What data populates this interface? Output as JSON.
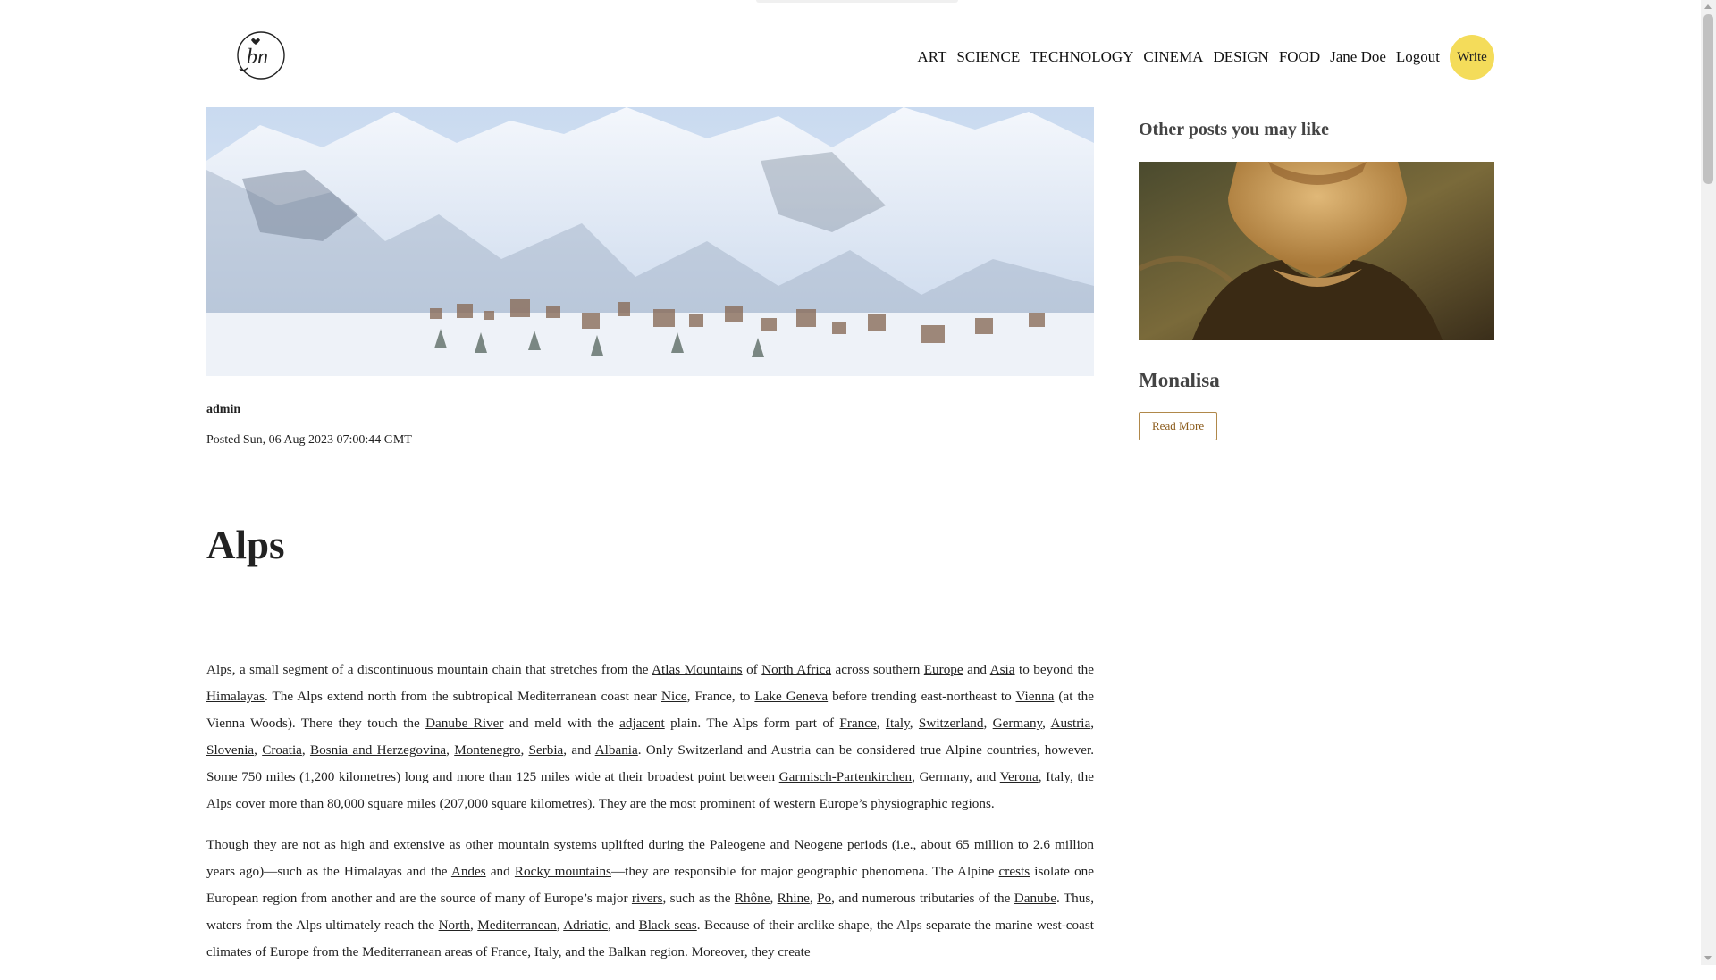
{
  "header": {
    "nav": [
      {
        "label": "ART"
      },
      {
        "label": "SCIENCE"
      },
      {
        "label": "TECHNOLOGY"
      },
      {
        "label": "CINEMA"
      },
      {
        "label": "DESIGN"
      },
      {
        "label": "FOOD"
      },
      {
        "label": "Jane Doe"
      },
      {
        "label": "Logout"
      }
    ],
    "write_label": "Write",
    "logo_icon": "bn-logo-icon"
  },
  "post": {
    "author": "admin",
    "posted": "Posted Sun, 06 Aug 2023 07:00:44 GMT",
    "title": "Alps",
    "hero_image": "snowy-alpine-village-image"
  },
  "article": {
    "p1": [
      "Alps, a small segment of a discontinuous mountain chain that stretches from the ",
      "Atlas Mountains",
      " of ",
      "North Africa",
      " across southern ",
      "Europe",
      " and ",
      "Asia",
      " to beyond the ",
      "Himalayas",
      ". The Alps extend north from the subtropical Mediterranean coast near ",
      "Nice",
      ", France, to ",
      "Lake Geneva",
      " before trending east-northeast to ",
      "Vienna",
      " (at the Vienna Woods). There they touch the ",
      "Danube River",
      " and meld with the ",
      "adjacent",
      " plain. The Alps form part of ",
      "France",
      ", ",
      "Italy",
      ", ",
      "Switzerland",
      ", ",
      "Germany",
      ", ",
      "Austria",
      ", ",
      "Slovenia",
      ", ",
      "Croatia",
      ", ",
      "Bosnia and Herzegovina",
      ", ",
      "Montenegro",
      ", ",
      "Serbia",
      ", and ",
      "Albania",
      ". Only Switzerland and Austria can be considered true Alpine countries, however. Some 750 miles (1,200 kilometres) long and more than 125 miles wide at their broadest point between ",
      "Garmisch-Partenkirchen",
      ", Germany, and ",
      "Verona",
      ", Italy, the Alps cover more than 80,000 square miles (207,000 square kilometres). They are the most prominent of western Europe’s physiographic regions."
    ],
    "p2": [
      "Though they are not as high and extensive as other mountain systems uplifted during the Paleogene and Neogene periods (i.e., about 65 million to 2.6 million years ago)—such as the Himalayas and the ",
      "Andes",
      " and ",
      "Rocky mountains",
      "—they are responsible for major geographic phenomena. The Alpine ",
      "crests",
      " isolate one European region from another and are the source of many of Europe’s major ",
      "rivers",
      ", such as the ",
      "Rhône",
      ", ",
      "Rhine",
      ", ",
      "Po",
      ", and numerous tributaries of the ",
      "Danube",
      ". Thus, waters from the Alps ultimately reach the ",
      "North",
      ", ",
      "Mediterranean",
      ", ",
      "Adriatic",
      ", and ",
      "Black seas",
      ". Because of their arclike shape, the Alps separate the marine west-coast climates of Europe from the Mediterranean areas of France, Italy, and the Balkan region. Moreover, they create"
    ]
  },
  "sidebar": {
    "heading": "Other posts you may like",
    "post_title": "Monalisa",
    "post_image": "monalisa-painting-image",
    "read_more_label": "Read More"
  }
}
